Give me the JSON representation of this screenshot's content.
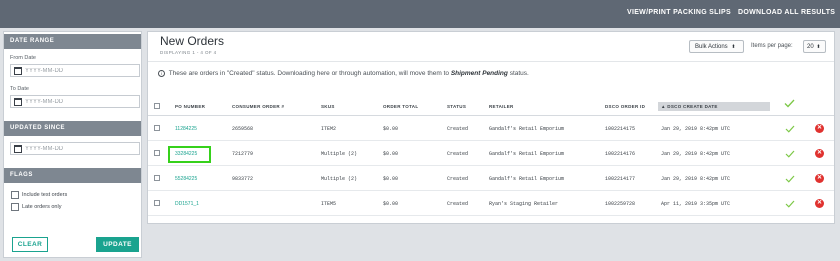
{
  "topbar": {
    "packing_slips": "VIEW/PRINT PACKING SLIPS",
    "download_all": "DOWNLOAD ALL RESULTS"
  },
  "sidebar": {
    "date_range": {
      "heading": "DATE RANGE",
      "from_label": "From Date",
      "from_placeholder": "YYYY-MM-DD",
      "to_label": "To Date",
      "to_placeholder": "YYYY-MM-DD"
    },
    "updated_since": {
      "heading": "UPDATED SINCE",
      "placeholder": "YYYY-MM-DD"
    },
    "flags": {
      "heading": "FLAGS",
      "items": [
        "Include test orders",
        "Late orders only"
      ]
    },
    "clear_label": "CLEAR",
    "update_label": "UPDATE"
  },
  "main": {
    "title": "New Orders",
    "subtitle": "DISPLAYING 1 - 4 OF 4",
    "bulk_actions": "Bulk Actions",
    "items_per_page_label": "Items per page:",
    "items_per_page_value": "20",
    "info_prefix": "These are orders in \"Created\" status. Downloading here or through automation, will move them to",
    "info_status": "Shipment Pending",
    "info_suffix": "status.",
    "columns": [
      "PO NUMBER",
      "CONSUMER ORDER #",
      "SKUS",
      "ORDER TOTAL",
      "STATUS",
      "RETAILER",
      "DSCO ORDER ID",
      "▲ DSCO CREATE DATE"
    ],
    "rows": [
      {
        "po": "11284225",
        "consumer": "2659568",
        "skus": "ITEM2",
        "total": "$0.00",
        "status": "Created",
        "retailer": "Gandalf's Retail Emporium",
        "dsco_id": "1002214175",
        "created": "Jan 29, 2019 8:42pm UTC"
      },
      {
        "po": "33284225",
        "consumer": "7212779",
        "skus": "Multiple (2)",
        "total": "$0.00",
        "status": "Created",
        "retailer": "Gandalf's Retail Emporium",
        "dsco_id": "1002214176",
        "created": "Jan 29, 2019 8:42pm UTC"
      },
      {
        "po": "55284225",
        "consumer": "9833772",
        "skus": "Multiple (2)",
        "total": "$0.00",
        "status": "Created",
        "retailer": "Gandalf's Retail Emporium",
        "dsco_id": "1002214177",
        "created": "Jan 29, 2019 8:42pm UTC"
      },
      {
        "po": "DD1571_1",
        "consumer": "",
        "skus": "ITEM5",
        "total": "$0.00",
        "status": "Created",
        "retailer": "Ryan's Staging Retailer",
        "dsco_id": "1002259728",
        "created": "Apr 11, 2019 3:35pm UTC"
      }
    ]
  },
  "colors": {
    "topbar": "#5f6874",
    "accent": "#1aa38f",
    "check": "#7cc846",
    "delete": "#e0322f",
    "highlight": "#36d11b"
  },
  "icons": [
    "calendar-icon",
    "info-icon",
    "check-icon",
    "delete-icon",
    "dropdown-chevron-icon"
  ]
}
